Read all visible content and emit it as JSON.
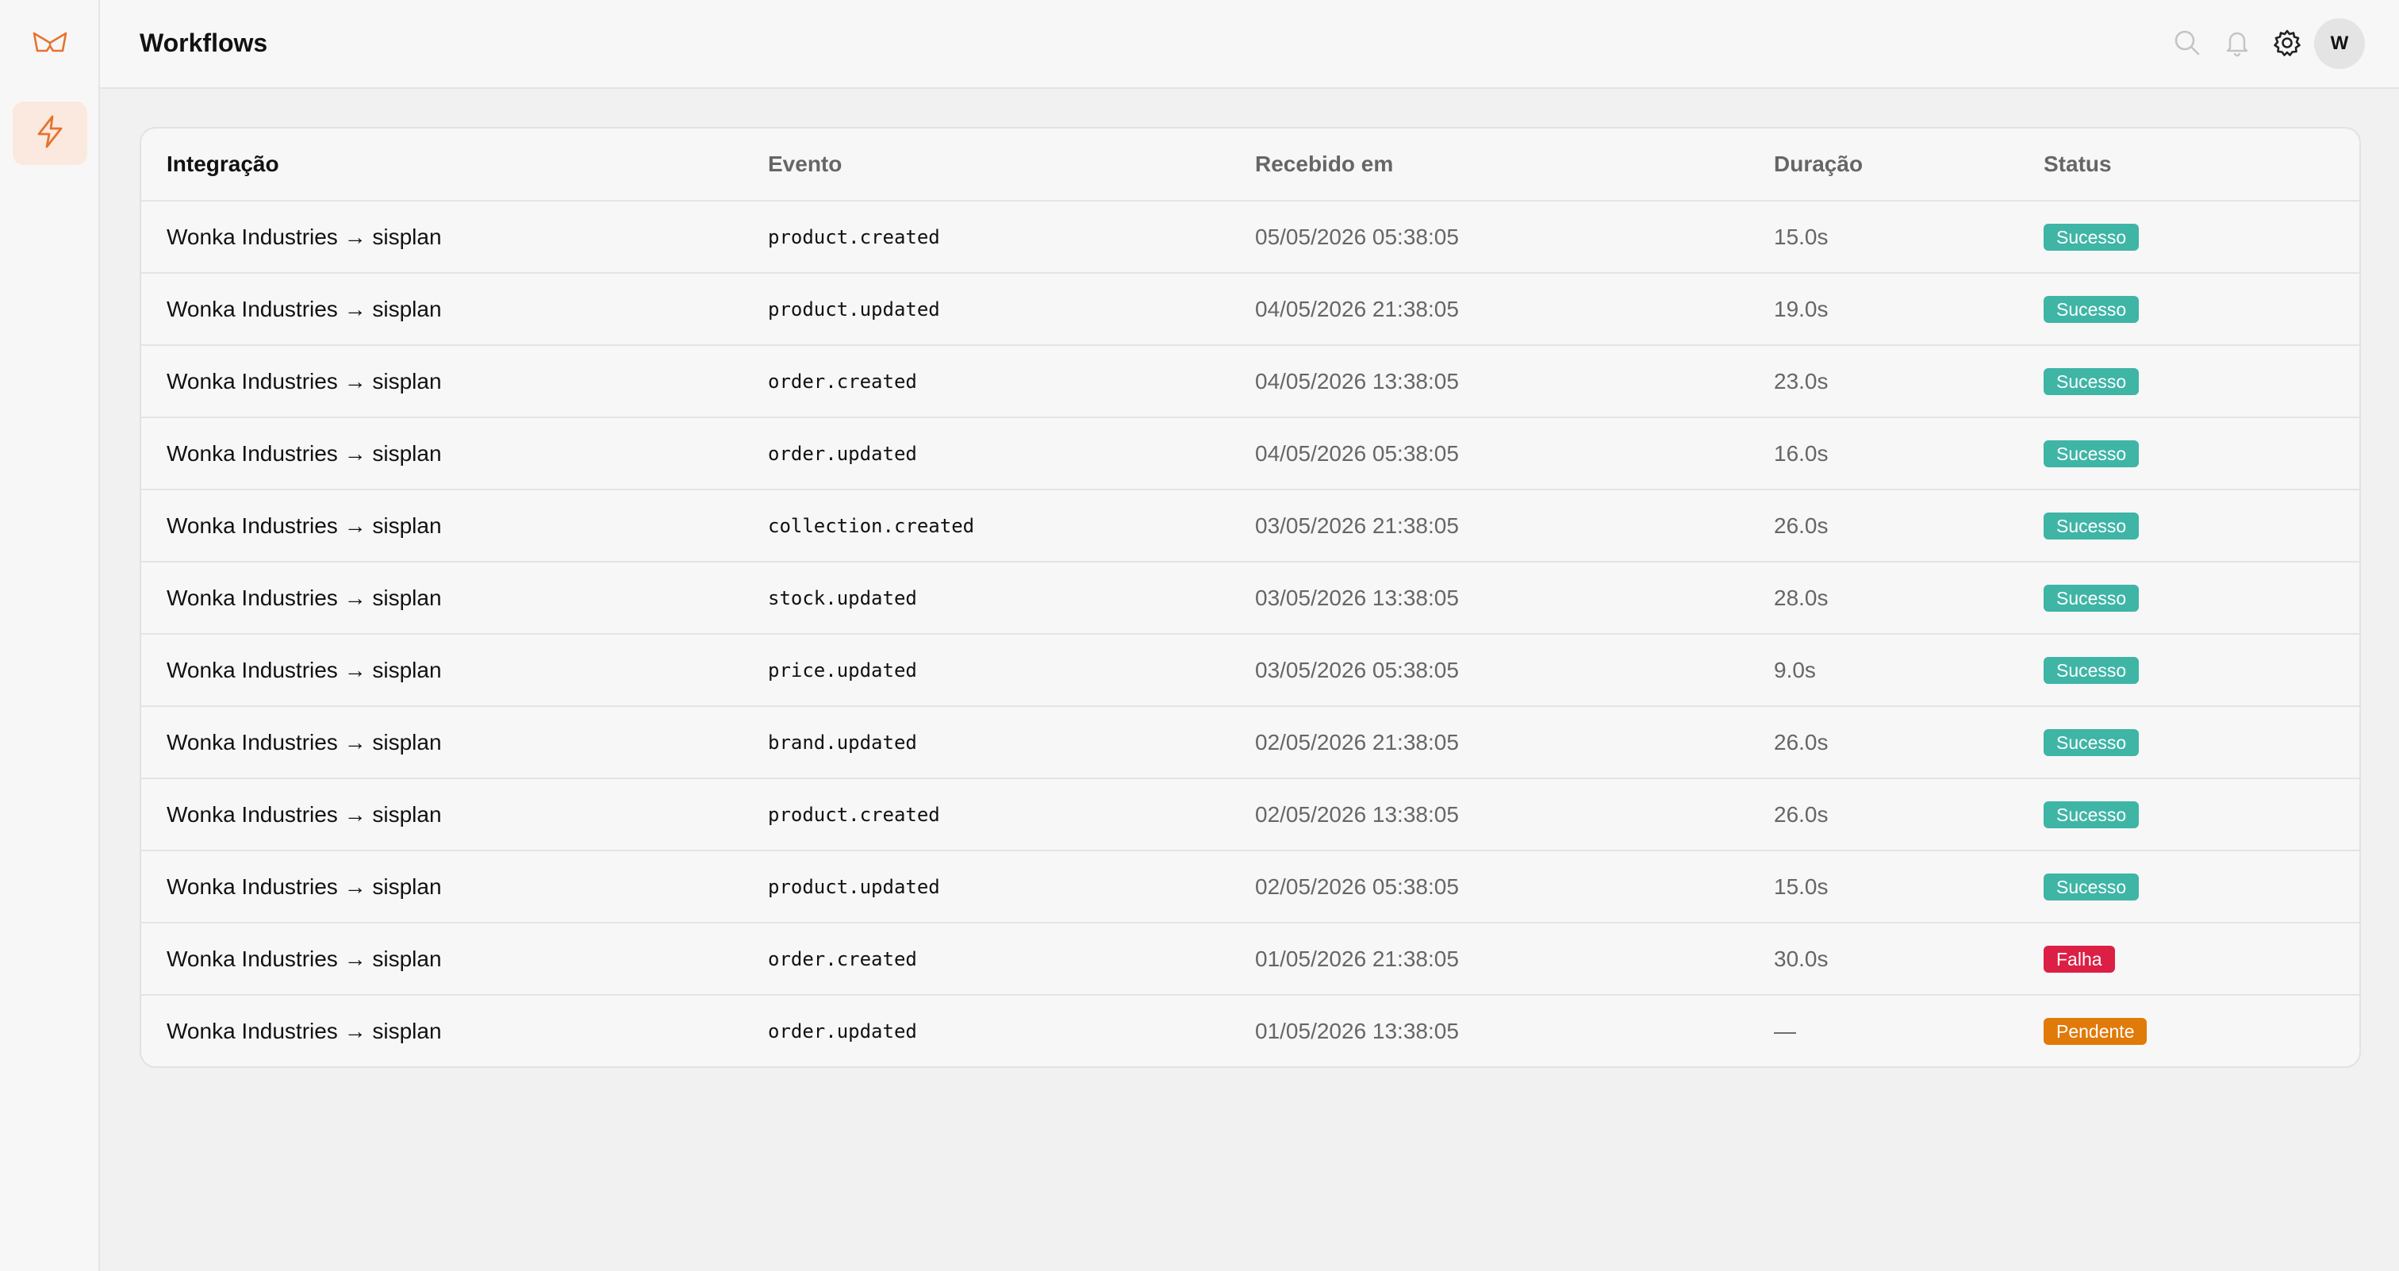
{
  "app": {
    "logo_icon": "butterfly-logo-icon",
    "nav": [
      {
        "icon": "lightning-bolt-icon",
        "label": "Workflows",
        "active": true
      }
    ]
  },
  "header": {
    "title": "Workflows",
    "icons": [
      "search-icon",
      "bell-icon",
      "gear-icon"
    ],
    "avatar_initial": "W"
  },
  "colors": {
    "accent": "#e8722e",
    "success": "#3fb5a6",
    "failure": "#dc1f45",
    "pending": "#e07a08"
  },
  "table": {
    "columns": [
      "Integração",
      "Evento",
      "Recebido em",
      "Duração",
      "Status"
    ],
    "rows": [
      {
        "integration": "Wonka Industries → sisplan",
        "event": "product.created",
        "received": "05/05/2026 05:38:05",
        "duration": "15.0s",
        "status": "Sucesso"
      },
      {
        "integration": "Wonka Industries → sisplan",
        "event": "product.updated",
        "received": "04/05/2026 21:38:05",
        "duration": "19.0s",
        "status": "Sucesso"
      },
      {
        "integration": "Wonka Industries → sisplan",
        "event": "order.created",
        "received": "04/05/2026 13:38:05",
        "duration": "23.0s",
        "status": "Sucesso"
      },
      {
        "integration": "Wonka Industries → sisplan",
        "event": "order.updated",
        "received": "04/05/2026 05:38:05",
        "duration": "16.0s",
        "status": "Sucesso"
      },
      {
        "integration": "Wonka Industries → sisplan",
        "event": "collection.created",
        "received": "03/05/2026 21:38:05",
        "duration": "26.0s",
        "status": "Sucesso"
      },
      {
        "integration": "Wonka Industries → sisplan",
        "event": "stock.updated",
        "received": "03/05/2026 13:38:05",
        "duration": "28.0s",
        "status": "Sucesso"
      },
      {
        "integration": "Wonka Industries → sisplan",
        "event": "price.updated",
        "received": "03/05/2026 05:38:05",
        "duration": "9.0s",
        "status": "Sucesso"
      },
      {
        "integration": "Wonka Industries → sisplan",
        "event": "brand.updated",
        "received": "02/05/2026 21:38:05",
        "duration": "26.0s",
        "status": "Sucesso"
      },
      {
        "integration": "Wonka Industries → sisplan",
        "event": "product.created",
        "received": "02/05/2026 13:38:05",
        "duration": "26.0s",
        "status": "Sucesso"
      },
      {
        "integration": "Wonka Industries → sisplan",
        "event": "product.updated",
        "received": "02/05/2026 05:38:05",
        "duration": "15.0s",
        "status": "Sucesso"
      },
      {
        "integration": "Wonka Industries → sisplan",
        "event": "order.created",
        "received": "01/05/2026 21:38:05",
        "duration": "30.0s",
        "status": "Falha"
      },
      {
        "integration": "Wonka Industries → sisplan",
        "event": "order.updated",
        "received": "01/05/2026 13:38:05",
        "duration": "—",
        "status": "Pendente"
      }
    ]
  }
}
